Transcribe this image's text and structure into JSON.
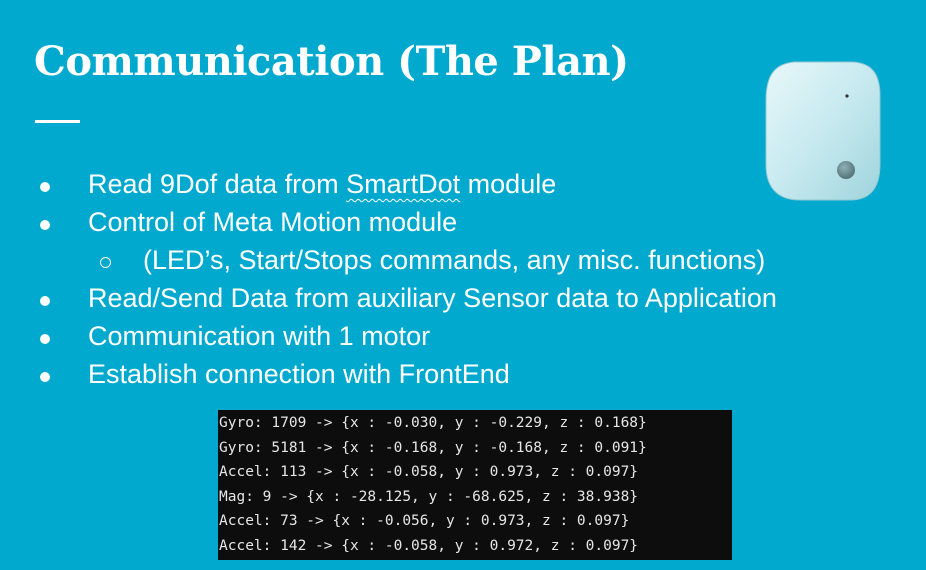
{
  "slide": {
    "title": "Communication (The Plan)",
    "bullets": [
      {
        "pre": "Read 9Dof data from ",
        "mark": "SmartDot",
        "post": " module"
      },
      {
        "text": "Control of Meta Motion module"
      },
      {
        "text": "(LED’s, Start/Stops commands, any misc. functions)",
        "sub": true
      },
      {
        "text": "Read/Send Data from auxiliary Sensor data to Application"
      },
      {
        "text": "Communication with 1 motor"
      },
      {
        "text": "Establish connection with FrontEnd"
      }
    ],
    "console_lines": [
      "Gyro: 1709 -> {x : -0.030, y : -0.229, z : 0.168}",
      "Gyro: 5181 -> {x : -0.168, y : -0.168, z : 0.091}",
      "Accel: 113 -> {x : -0.058, y : 0.973, z : 0.097}",
      "Mag: 9 -> {x : -28.125, y : -68.625, z : 38.938}",
      "Accel: 73 -> {x : -0.056, y : 0.973, z : 0.097}",
      "Accel: 142 -> {x : -0.058, y : 0.972, z : 0.097}"
    ]
  },
  "colors": {
    "background": "#01a9cf",
    "text": "#ffffff",
    "console_bg": "#0d0d0d",
    "console_text": "#e6e6e6",
    "device_body": "#bfe6ec"
  },
  "icons": {
    "device": "sensor-device-image"
  }
}
